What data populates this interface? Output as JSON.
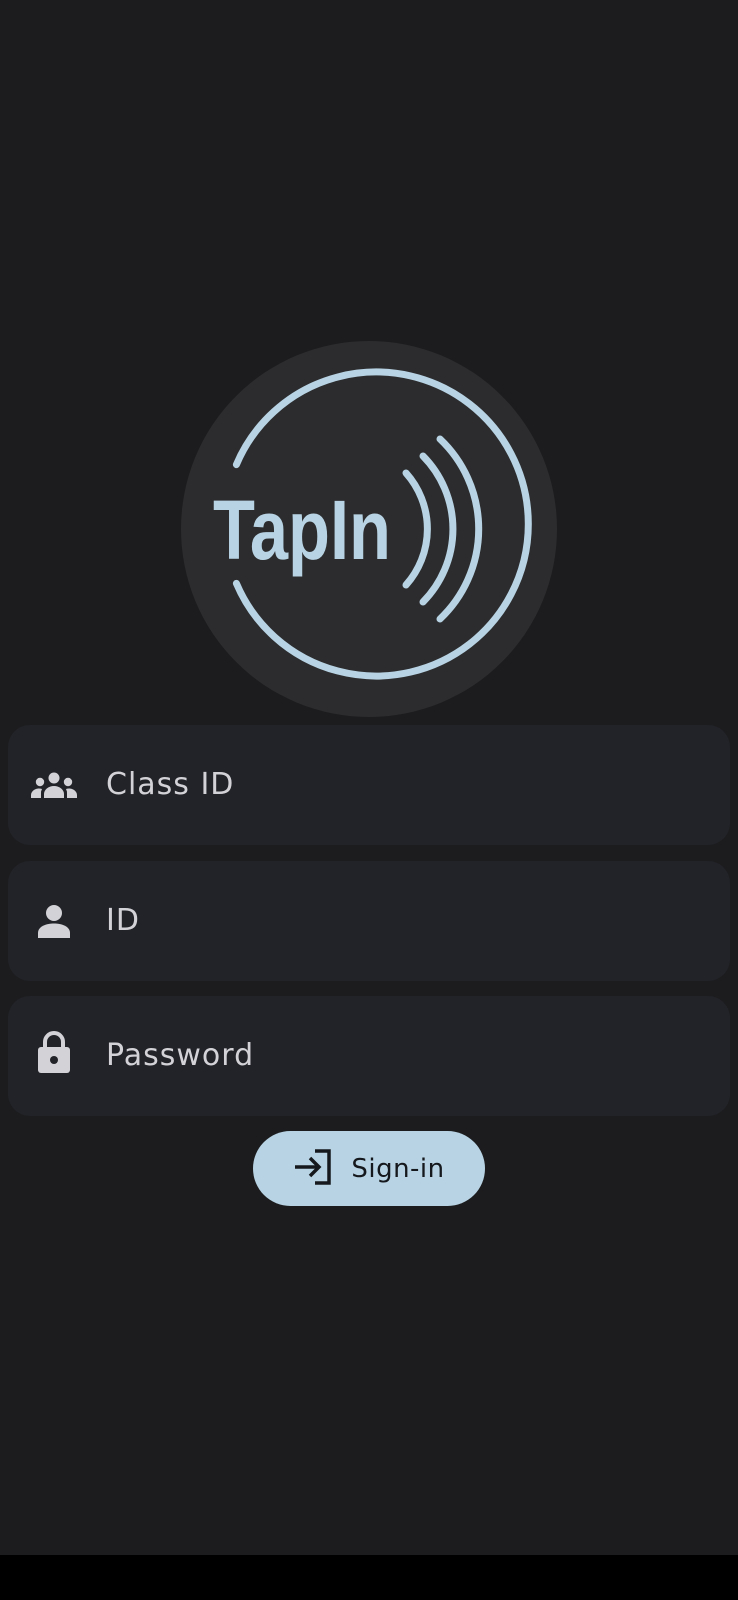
{
  "app": {
    "logo_text": "TapIn"
  },
  "form": {
    "class_id": {
      "placeholder": "Class ID",
      "icon": "group-icon"
    },
    "user_id": {
      "placeholder": "ID",
      "icon": "person-icon"
    },
    "password": {
      "placeholder": "Password",
      "icon": "lock-icon"
    }
  },
  "signin_button": {
    "label": "Sign-in",
    "icon": "login-icon"
  },
  "colors": {
    "background": "#1c1c1e",
    "logo_circle": "#2c2c2e",
    "accent": "#b8d4e4",
    "field_background": "#222329",
    "field_text": "#d3d3d7"
  }
}
